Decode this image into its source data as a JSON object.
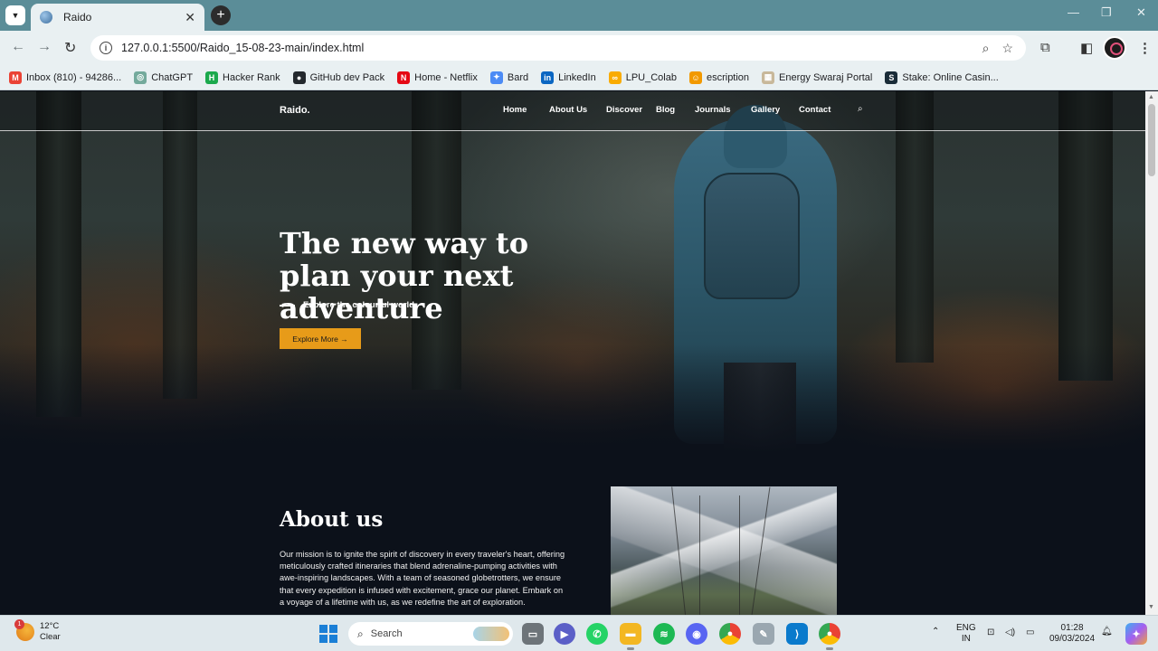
{
  "browser": {
    "tab_title": "Raido",
    "tab_close": "✕",
    "new_tab": "+",
    "window_controls": {
      "minimize": "—",
      "maximize": "❐",
      "close": "✕"
    },
    "url": "127.0.0.1:5500/Raido_15-08-23-main/index.html",
    "bookmarks": [
      {
        "label": "Inbox (810) - 94286...",
        "icon": "gmail-icon",
        "color": "#ea4335",
        "glyph": "M"
      },
      {
        "label": "ChatGPT",
        "icon": "chatgpt-icon",
        "color": "#74aa9c",
        "glyph": "◎"
      },
      {
        "label": "Hacker Rank",
        "icon": "hackerrank-icon",
        "color": "#1ba94c",
        "glyph": "H"
      },
      {
        "label": "GitHub dev Pack",
        "icon": "github-icon",
        "color": "#24292e",
        "glyph": "●"
      },
      {
        "label": "Home - Netflix",
        "icon": "netflix-icon",
        "color": "#e50914",
        "glyph": "N"
      },
      {
        "label": "Bard",
        "icon": "bard-icon",
        "color": "#4c8bf5",
        "glyph": "✦"
      },
      {
        "label": "LinkedIn",
        "icon": "linkedin-icon",
        "color": "#0a66c2",
        "glyph": "in"
      },
      {
        "label": "LPU_Colab",
        "icon": "colab-icon",
        "color": "#f9ab00",
        "glyph": "∞"
      },
      {
        "label": "escription",
        "icon": "bookmark-icon",
        "color": "#f29900",
        "glyph": "☺"
      },
      {
        "label": "Energy Swaraj Portal",
        "icon": "portal-icon",
        "color": "#c8b89a",
        "glyph": "▦"
      },
      {
        "label": "Stake: Online Casin...",
        "icon": "stake-icon",
        "color": "#1a2c38",
        "glyph": "S"
      }
    ]
  },
  "site": {
    "brand": "Raido.",
    "nav": [
      "Home",
      "About Us",
      "Discover",
      "Blog",
      "Journals",
      "Gallery",
      "Contact"
    ],
    "hero_title": "The new way to plan your next adventure",
    "hero_subtitle": "Explore the colourful world",
    "hero_button": "Explore More →",
    "about_title": "About us",
    "about_text": "Our mission is to ignite the spirit of discovery in every traveler's heart, offering meticulously crafted itineraries that blend adrenaline-pumping activities with awe-inspiring landscapes. With a team of seasoned globetrotters, we ensure that every expedition is infused with excitement, grace our planet. Embark on a voyage of a lifetime with us, as we redefine the art of exploration."
  },
  "taskbar": {
    "weather_temp": "12°C",
    "weather_desc": "Clear",
    "weather_badge": "1",
    "search_label": "Search",
    "lang_top": "ENG",
    "lang_bottom": "IN",
    "time": "01:28",
    "date": "09/03/2024"
  },
  "colors": {
    "accent": "#e79b19",
    "chrome": "#5b8d98",
    "page_bg": "#0c111a"
  }
}
